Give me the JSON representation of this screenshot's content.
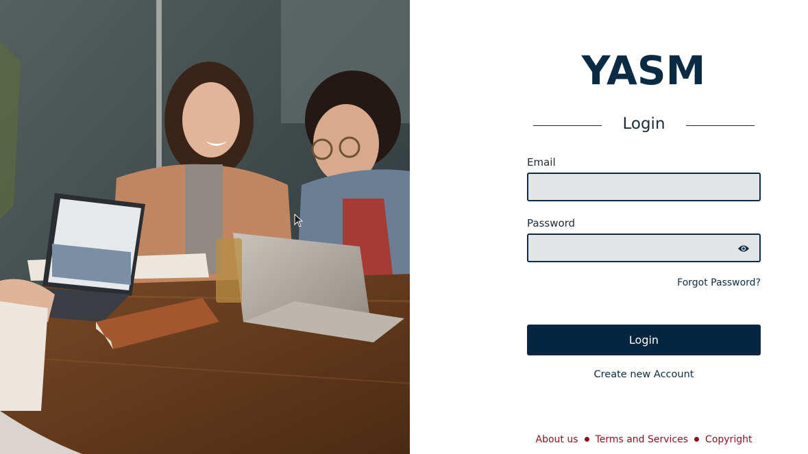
{
  "app": {
    "logo": "YASM"
  },
  "login": {
    "heading": "Login",
    "email_label": "Email",
    "email_value": "",
    "email_placeholder": "",
    "password_label": "Password",
    "password_value": "",
    "password_placeholder": "",
    "forgot_label": "Forgot Password?",
    "submit_label": "Login",
    "create_label": "Create new Account"
  },
  "footer": {
    "links": [
      "About us",
      "Terms and Services",
      "Copyright"
    ]
  },
  "icons": {
    "password_toggle": "eye-icon"
  },
  "colors": {
    "brand": "#0b2a44",
    "button": "#062541",
    "field_bg": "#e2e4e5",
    "footer_link": "#8a0f1b"
  }
}
